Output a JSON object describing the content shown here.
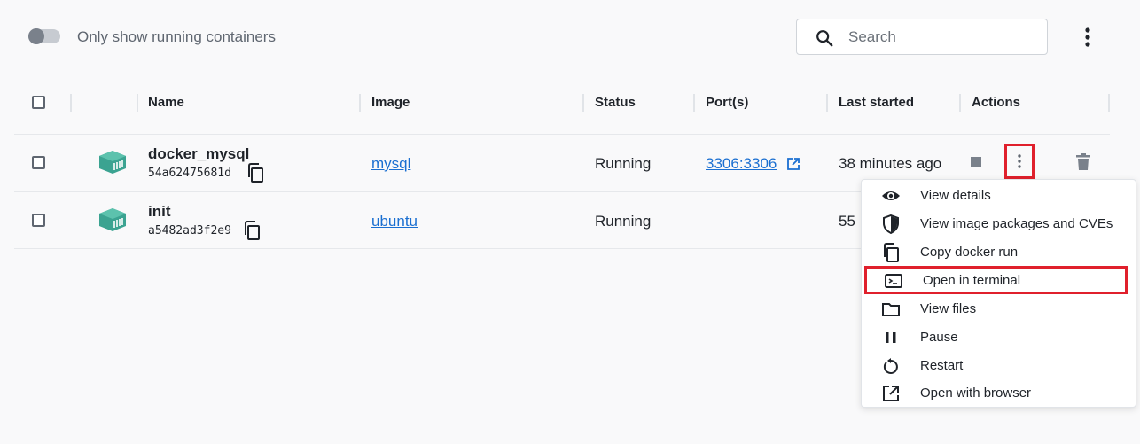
{
  "toolbar": {
    "toggle_label": "Only show running containers",
    "toggle_on": false,
    "search_placeholder": "Search"
  },
  "table": {
    "columns": [
      "Name",
      "Image",
      "Status",
      "Port(s)",
      "Last started",
      "Actions"
    ],
    "rows": [
      {
        "name": "docker_mysql",
        "id": "54a62475681d",
        "image": "mysql",
        "status": "Running",
        "ports": "3306:3306",
        "last_started": "38 minutes ago"
      },
      {
        "name": "init",
        "id": "a5482ad3f2e9",
        "image": "ubuntu",
        "status": "Running",
        "ports": "",
        "last_started": "55"
      }
    ]
  },
  "menu": {
    "items": [
      {
        "label": "View details",
        "icon": "eye-icon"
      },
      {
        "label": "View image packages and CVEs",
        "icon": "shield-icon"
      },
      {
        "label": "Copy docker run",
        "icon": "copy-icon"
      },
      {
        "label": "Open in terminal",
        "icon": "terminal-icon"
      },
      {
        "label": "View files",
        "icon": "folder-icon"
      },
      {
        "label": "Pause",
        "icon": "pause-icon"
      },
      {
        "label": "Restart",
        "icon": "restart-icon"
      },
      {
        "label": "Open with browser",
        "icon": "open-external-icon"
      }
    ]
  },
  "colors": {
    "accent_link": "#1a6fd1",
    "container_icon": "#3ba391",
    "highlight_box": "#e0202c"
  }
}
